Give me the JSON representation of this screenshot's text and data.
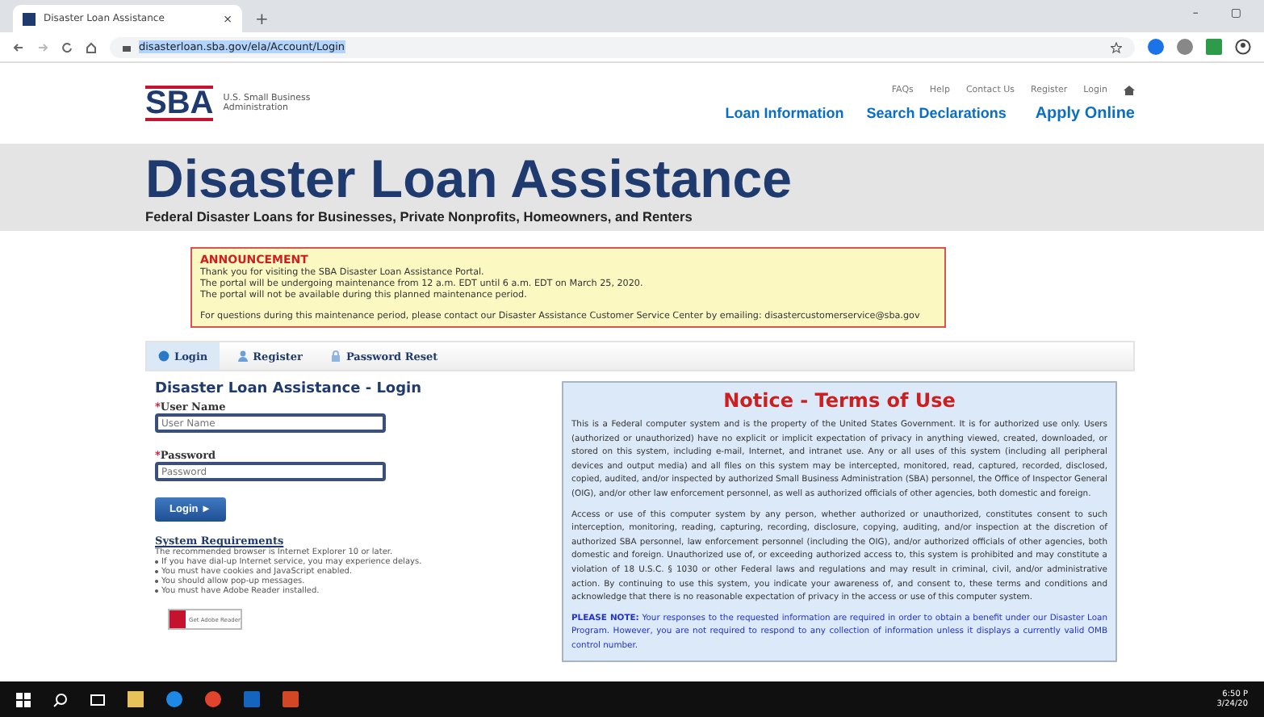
{
  "browser": {
    "tab_title": "Disaster Loan Assistance",
    "tab_close": "×",
    "new_tab": "+",
    "url": "disasterloan.sba.gov/ela/Account/Login",
    "window_buttons": [
      "–",
      "▢"
    ]
  },
  "header": {
    "logo_text": "SBA",
    "agency": [
      "U.S. Small Business",
      "Administration"
    ],
    "utility_links": [
      "FAQs",
      "Help",
      "Contact Us",
      "Register",
      "Login"
    ],
    "main_links": [
      "Loan Information",
      "Search Declarations",
      "Apply Online"
    ]
  },
  "banner": {
    "title": "Disaster Loan Assistance",
    "subtitle": "Federal Disaster Loans for Businesses, Private Nonprofits, Homeowners, and Renters"
  },
  "announcement": {
    "heading": "ANNOUNCEMENT",
    "lines": [
      "Thank you for visiting the SBA Disaster Loan Assistance Portal.",
      "The portal will be undergoing maintenance from 12 a.m. EDT until 6 a.m. EDT on March 25, 2020.",
      "The portal will not be available during this planned maintenance period."
    ],
    "contact": "For questions during this maintenance period, please contact our Disaster Assistance Customer Service Center by emailing: disastercustomerservice@sba.gov"
  },
  "tabs": [
    {
      "label": "Login",
      "selected": true
    },
    {
      "label": "Register",
      "selected": false
    },
    {
      "label": "Password Reset",
      "selected": false
    }
  ],
  "login": {
    "title": "Disaster Loan Assistance - Login",
    "required_mark": "*",
    "fields": [
      {
        "label": "User Name",
        "placeholder": "User Name"
      },
      {
        "label": "Password",
        "placeholder": "Password"
      }
    ],
    "button": "Login ►",
    "requirements_title": "System Requirements",
    "requirements_intro": "The recommended browser is Internet Explorer 10 or later.",
    "requirements": [
      "If you have dial-up Internet service, you may experience delays.",
      "You must have cookies and JavaScript enabled.",
      "You should allow pop-up messages.",
      "You must have Adobe Reader installed."
    ],
    "reader_badge": "Get Adobe Reader"
  },
  "terms": {
    "title": "Notice - Terms of Use",
    "paragraphs": [
      "This is a Federal computer system and is the property of the United States Government. It is for authorized use only. Users (authorized or unauthorized) have no explicit or implicit expectation of privacy in anything viewed, created, downloaded, or stored on this system, including e-mail, Internet, and intranet use. Any or all uses of this system (including all peripheral devices and output media) and all files on this system may be intercepted, monitored, read, captured, recorded, disclosed, copied, audited, and/or inspected by authorized Small Business Administration (SBA) personnel, the Office of Inspector General (OIG), and/or other law enforcement personnel, as well as authorized officials of other agencies, both domestic and foreign.",
      "Access or use of this computer system by any person, whether authorized or unauthorized, constitutes consent to such interception, monitoring, reading, capturing, recording, disclosure, copying, auditing, and/or inspection at the discretion of authorized SBA personnel, law enforcement personnel (including the OIG), and/or authorized officials of other agencies, both domestic and foreign. Unauthorized use of, or exceeding authorized access to, this system is prohibited and may constitute a violation of 18 U.S.C. § 1030 or other Federal laws and regulations and may result in criminal, civil, and/or administrative action. By continuing to use this system, you indicate your awareness of, and consent to, these terms and conditions and acknowledge that there is no reasonable expectation of privacy in the access or use of this computer system."
    ],
    "note": "**PLEASE NOTE:** Your responses to the requested information are required in order to obtain a benefit under our Disaster Loan Program. However, you are not required to respond to any collection of information unless it displays a currently valid OMB control number."
  },
  "taskbar": {
    "clock": [
      "6:50 P",
      "3/24/20"
    ]
  }
}
